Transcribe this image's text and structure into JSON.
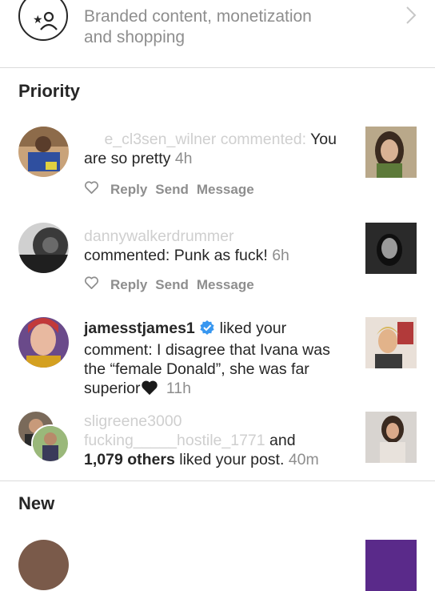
{
  "promo": {
    "text_line1": "Branded content, monetization",
    "text_line2": "and shopping"
  },
  "sections": {
    "priority": "Priority",
    "new": "New"
  },
  "notifications": [
    {
      "user": "e_cl3sen_wilner",
      "action": "commented:",
      "text_line1_end": "You",
      "text_line2": "are so pretty",
      "time": "4h",
      "actions": {
        "reply": "Reply",
        "send": "Send",
        "message": "Message"
      }
    },
    {
      "user": "dannywalkerdrummer",
      "text": "commented: Punk as fuck!",
      "time": "6h",
      "actions": {
        "reply": "Reply",
        "send": "Send",
        "message": "Message"
      }
    },
    {
      "user": "jamesstjames1",
      "line1_rest": "liked your",
      "line2": "comment: I disagree that Ivana was",
      "line3": "the “female Donald”, she was far",
      "line4": "superior",
      "time": "11h"
    },
    {
      "user": "sligreene3000",
      "line1_faded": "fucking_____hostile_1771",
      "line1_rest": "and",
      "others": "1,079 others",
      "rest": "liked your post.",
      "time": "40m"
    }
  ],
  "colors": {
    "verified": "#3897f0",
    "text": "#262626",
    "muted": "#8e8e8e",
    "divider": "#dbdbdb"
  }
}
